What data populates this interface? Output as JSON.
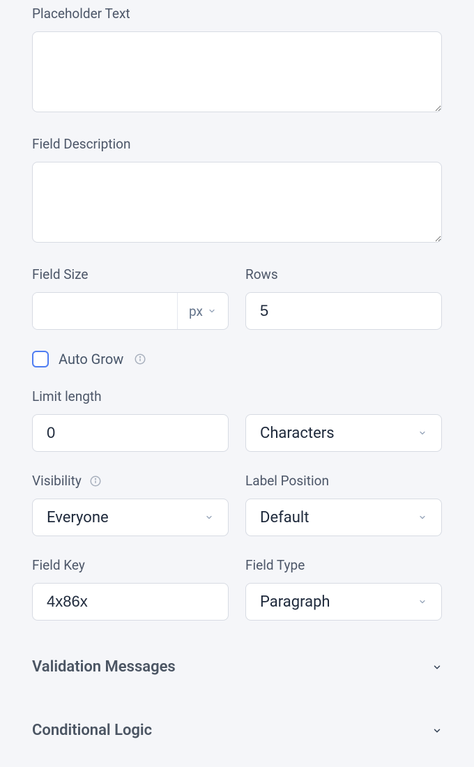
{
  "labels": {
    "placeholder_text": "Placeholder Text",
    "field_description": "Field Description",
    "field_size": "Field Size",
    "rows": "Rows",
    "auto_grow": "Auto Grow",
    "limit_length": "Limit length",
    "visibility": "Visibility",
    "label_position": "Label Position",
    "field_key": "Field Key",
    "field_type": "Field Type"
  },
  "values": {
    "placeholder_text": "",
    "field_description": "",
    "field_size": "",
    "size_unit": "px",
    "rows": "5",
    "auto_grow": false,
    "limit_length": "0",
    "limit_unit": "Characters",
    "visibility": "Everyone",
    "label_position": "Default",
    "field_key": "4x86x",
    "field_type": "Paragraph"
  },
  "sections": {
    "validation_messages": "Validation Messages",
    "conditional_logic": "Conditional Logic"
  }
}
